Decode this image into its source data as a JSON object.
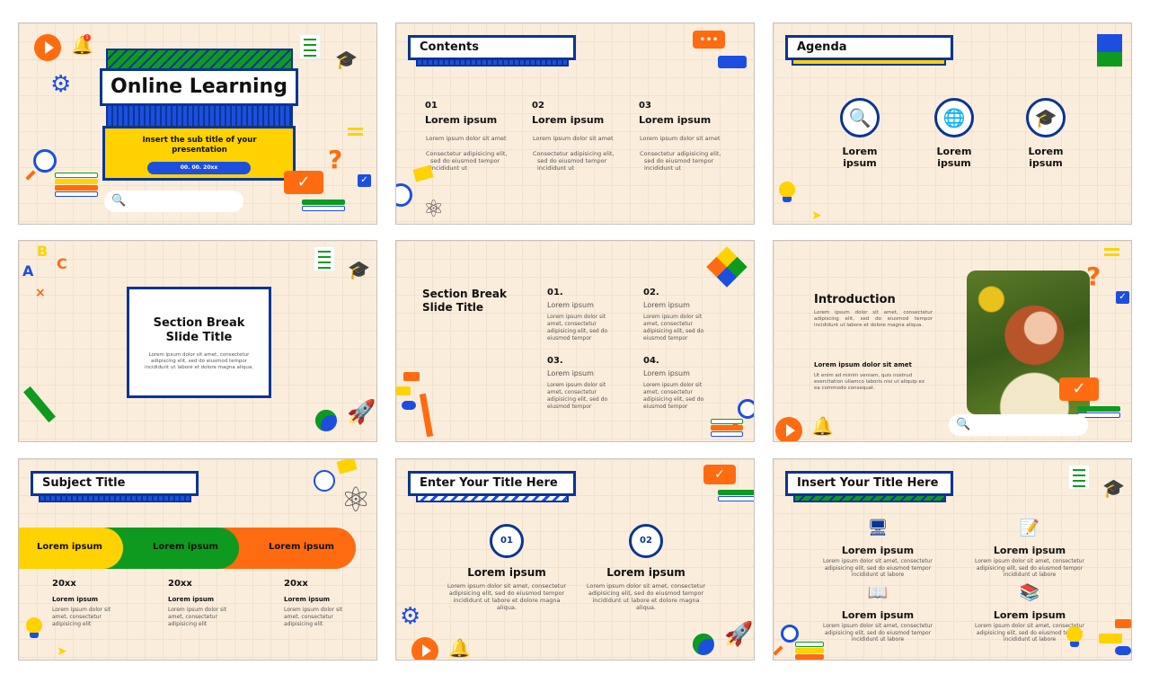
{
  "colors": {
    "navy": "#0b3593",
    "blue": "#1c4fe0",
    "green": "#0e9a1f",
    "yellow": "#ffd200",
    "orange": "#ff6b10",
    "cream": "#fbeddc"
  },
  "slide1": {
    "title": "Online Learning",
    "subtitle": "Insert the sub title of your presentation",
    "date": "00. 00. 20xx",
    "bell_badge": "1",
    "icons": [
      "play-icon",
      "bell-icon",
      "gear-icon",
      "note-icon",
      "graduation-cap-icon",
      "magnifier-icon",
      "books-icon",
      "search-icon",
      "question-mark-icon",
      "check-bubble-icon",
      "chat-check-icon",
      "equals-icon"
    ]
  },
  "slide2": {
    "title": "Contents",
    "items": [
      {
        "num": "01",
        "title": "Lorem ipsum",
        "bullets": [
          "Lorem ipsum dolor sit amet",
          "Consectetur adipisicing elit, sed do eiusmod tempor incididunt ut"
        ]
      },
      {
        "num": "02",
        "title": "Lorem ipsum",
        "bullets": [
          "Lorem ipsum dolor sit amet",
          "Consectetur adipisicing elit, sed do eiusmod tempor incididunt ut"
        ]
      },
      {
        "num": "03",
        "title": "Lorem ipsum",
        "bullets": [
          "Lorem ipsum dolor sit amet",
          "Consectetur adipisicing elit, sed do eiusmod tempor incididunt ut"
        ]
      }
    ]
  },
  "slide3": {
    "title": "Agenda",
    "items": [
      {
        "label": "Lorem ipsum",
        "icon": "book-search-icon"
      },
      {
        "label": "Lorem ipsum",
        "icon": "globe-book-icon"
      },
      {
        "label": "Lorem ipsum",
        "icon": "globe-cap-icon"
      }
    ]
  },
  "slide4": {
    "title": "Section Break Slide Title",
    "body": "Lorem ipsum dolor sit amet, consectetur adipiscing elit, sed do eiusmod tempor incididunt ut labore et dolore magna aliqua.",
    "letters": [
      "A",
      "B",
      "C"
    ]
  },
  "slide5": {
    "title": "Section Break Slide Title",
    "items": [
      {
        "num": "01.",
        "title": "Lorem ipsum",
        "body": "Lorem ipsum dolor sit amet, consectetur adipisicing elit, sed do eiusmod tempor"
      },
      {
        "num": "02.",
        "title": "Lorem ipsum",
        "body": "Lorem ipsum dolor sit amet, consectetur adipisicing elit, sed do eiusmod tempor"
      },
      {
        "num": "03.",
        "title": "Lorem ipsum",
        "body": "Lorem ipsum dolor sit amet, consectetur adipisicing elit, sed do eiusmod tempor"
      },
      {
        "num": "04.",
        "title": "Lorem ipsum",
        "body": "Lorem ipsum dolor sit amet, consectetur adipisicing elit, sed do eiusmod tempor"
      }
    ]
  },
  "slide6": {
    "title": "Introduction",
    "body": "Lorem ipsum dolor sit amet, consectetur adipiscing elit, sed do eiusmod tempor incididunt ut labore et dolore magna aliqua.",
    "subtitle": "Lorem ipsum dolor sit amet",
    "body2": "Ut enim ad minim veniam, quis nostrud exercitation ullamco laboris nisi ut aliquip ex ea commodo consequat."
  },
  "slide7": {
    "title": "Subject Title",
    "bands": [
      "Lorem ipsum",
      "Lorem ipsum",
      "Lorem ipsum"
    ],
    "items": [
      {
        "year": "20xx",
        "title": "Lorem ipsum",
        "body": "Lorem ipsum dolor sit amet, consectetur adipisicing elit"
      },
      {
        "year": "20xx",
        "title": "Lorem ipsum",
        "body": "Lorem ipsum dolor sit amet, consectetur adipisicing elit"
      },
      {
        "year": "20xx",
        "title": "Lorem ipsum",
        "body": "Lorem ipsum dolor sit amet, consectetur adipisicing elit"
      }
    ]
  },
  "slide8": {
    "title": "Enter Your Title Here",
    "items": [
      {
        "num": "01",
        "title": "Lorem ipsum",
        "body": "Lorem ipsum dolor sit amet, consectetur adipisicing elit, sed do eiusmod tempor incididunt ut labore et dolore magna aliqua."
      },
      {
        "num": "02",
        "title": "Lorem ipsum",
        "body": "Lorem ipsum dolor sit amet, consectetur adipisicing elit, sed do eiusmod tempor incididunt ut labore et dolore magna aliqua."
      }
    ]
  },
  "slide9": {
    "title": "Insert Your Title Here",
    "items": [
      {
        "title": "Lorem ipsum",
        "body": "Lorem ipsum dolor sit amet, consectetur adipisicing elit, sed do eiusmod tempor incididunt ut labore",
        "icon": "online-class-icon"
      },
      {
        "title": "Lorem ipsum",
        "body": "Lorem ipsum dolor sit amet, consectetur adipisicing elit, sed do eiusmod tempor incididunt ut labore",
        "icon": "web-edit-icon"
      },
      {
        "title": "Lorem ipsum",
        "body": "Lorem ipsum dolor sit amet, consectetur adipisicing elit, sed do eiusmod tempor incididunt ut labore",
        "icon": "ebook-icon"
      },
      {
        "title": "Lorem ipsum",
        "body": "Lorem ipsum dolor sit amet, consectetur adipisicing elit, sed do eiusmod tempor incididunt ut labore",
        "icon": "books-library-icon"
      }
    ]
  }
}
